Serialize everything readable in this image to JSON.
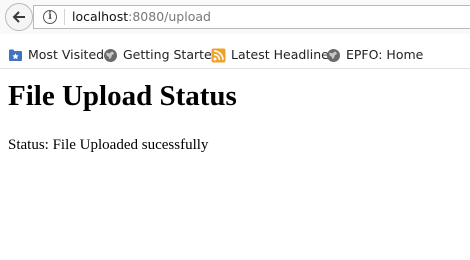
{
  "browser": {
    "url_host": "localhost",
    "url_rest": ":8080/upload"
  },
  "bookmarks": [
    {
      "label": "Most Visited",
      "icon": "bookmark-folder-icon"
    },
    {
      "label": "Getting Started",
      "icon": "globe-icon"
    },
    {
      "label": "Latest Headlines",
      "icon": "rss-feed-icon"
    },
    {
      "label": "EPFO: Home",
      "icon": "globe-icon"
    }
  ],
  "page": {
    "title": "File Upload Status",
    "status": "Status: File Uploaded sucessfully"
  },
  "colors": {
    "toolbar_bg": "#f9f9fa",
    "folder_blue": "#3f73c3",
    "feed_orange": "#f0a12a",
    "globe_gray": "#6b6b6b"
  }
}
